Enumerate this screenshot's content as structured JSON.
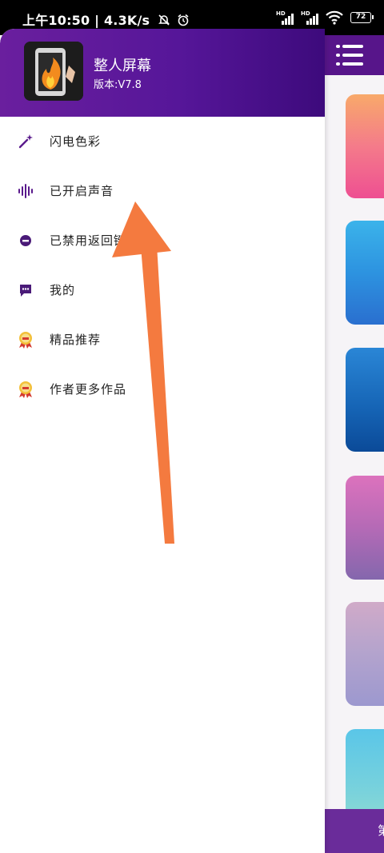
{
  "status_bar": {
    "time": "上午10:50",
    "net_speed": "4.3K/s",
    "sim1": "HD",
    "sim2": "HD",
    "battery": "72",
    "icons": [
      "mute-bell-icon",
      "alarm-icon",
      "signal-icon",
      "signal-icon",
      "wifi-icon",
      "battery-icon"
    ]
  },
  "drawer": {
    "app_name": "整人屏幕",
    "version": "版本:V7.8",
    "items": [
      {
        "label": "闪电色彩",
        "icon": "magic-wand-icon"
      },
      {
        "label": "已开启声音",
        "icon": "sound-wave-icon"
      },
      {
        "label": "已禁用返回键",
        "icon": "minus-circle-icon"
      },
      {
        "label": "我的",
        "icon": "chat-bubble-icon"
      },
      {
        "label": "精品推荐",
        "icon": "award-medal-icon"
      },
      {
        "label": "作者更多作品",
        "icon": "award-medal-icon"
      }
    ]
  },
  "background_app": {
    "topbar_color": "#57158a",
    "bottom_label": "第",
    "thumbnails": [
      {
        "name": "pink-flower-wallpaper",
        "colors": [
          "#f6a06a",
          "#ef5f8f"
        ]
      },
      {
        "name": "blue-pattern-wallpaper",
        "colors": [
          "#35a9e6",
          "#2f7ed8"
        ]
      },
      {
        "name": "blue-lightning-wallpaper",
        "colors": [
          "#1d74c8",
          "#0d4fa0"
        ]
      },
      {
        "name": "purple-pattern-wallpaper",
        "colors": [
          "#d46fb8",
          "#8a68b0"
        ]
      },
      {
        "name": "lavender-wallpaper",
        "colors": [
          "#c7a9c9",
          "#9e98cf"
        ]
      },
      {
        "name": "cyan-wallpaper",
        "colors": [
          "#59c6e6",
          "#88d8cf"
        ]
      }
    ]
  },
  "colors": {
    "drawer_header_start": "#6a1f9e",
    "drawer_header_end": "#3d0a7c",
    "icon_purple": "#5a1a8c",
    "arrow": "#f47a3f"
  }
}
